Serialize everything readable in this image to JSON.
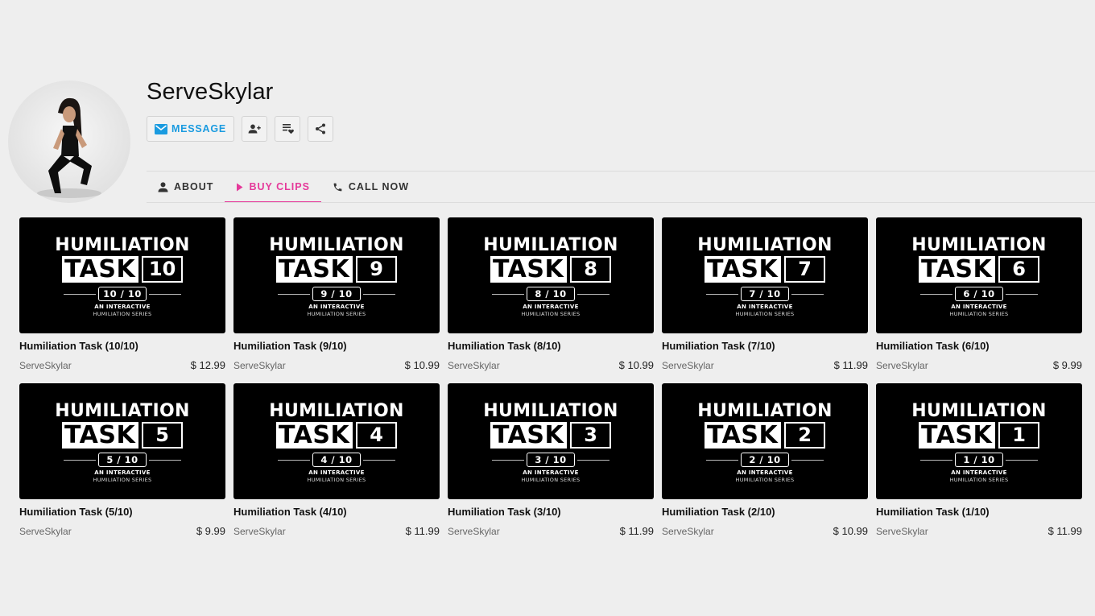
{
  "profile": {
    "name": "ServeSkylar"
  },
  "actions": {
    "message_label": "MESSAGE"
  },
  "tabs": [
    {
      "label": "ABOUT",
      "icon": "person-icon",
      "active": false
    },
    {
      "label": "BUY CLIPS",
      "icon": "play-icon",
      "active": true
    },
    {
      "label": "CALL NOW",
      "icon": "phone-icon",
      "active": false
    }
  ],
  "colors": {
    "accent_pink": "#e5399a",
    "message_blue": "#1a9be0",
    "background": "#eeeeee"
  },
  "thumbnail_text": {
    "line1": "HUMILIATION",
    "line2": "TASK",
    "sub1": "AN INTERACTIVE",
    "sub2": "HUMILIATION SERIES"
  },
  "clips": [
    {
      "title": "Humiliation Task (10/10)",
      "seller": "ServeSkylar",
      "price": "$ 12.99",
      "num": "10",
      "fraction": "10 / 10"
    },
    {
      "title": "Humiliation Task (9/10)",
      "seller": "ServeSkylar",
      "price": "$ 10.99",
      "num": "9",
      "fraction": "9 / 10"
    },
    {
      "title": "Humiliation Task (8/10)",
      "seller": "ServeSkylar",
      "price": "$ 10.99",
      "num": "8",
      "fraction": "8 / 10"
    },
    {
      "title": "Humiliation Task (7/10)",
      "seller": "ServeSkylar",
      "price": "$ 11.99",
      "num": "7",
      "fraction": "7 / 10"
    },
    {
      "title": "Humiliation Task (6/10)",
      "seller": "ServeSkylar",
      "price": "$ 9.99",
      "num": "6",
      "fraction": "6 / 10"
    },
    {
      "title": "Humiliation Task (5/10)",
      "seller": "ServeSkylar",
      "price": "$ 9.99",
      "num": "5",
      "fraction": "5 / 10"
    },
    {
      "title": "Humiliation Task (4/10)",
      "seller": "ServeSkylar",
      "price": "$ 11.99",
      "num": "4",
      "fraction": "4 / 10"
    },
    {
      "title": "Humiliation Task (3/10)",
      "seller": "ServeSkylar",
      "price": "$ 11.99",
      "num": "3",
      "fraction": "3 / 10"
    },
    {
      "title": "Humiliation Task (2/10)",
      "seller": "ServeSkylar",
      "price": "$ 10.99",
      "num": "2",
      "fraction": "2 / 10"
    },
    {
      "title": "Humiliation Task (1/10)",
      "seller": "ServeSkylar",
      "price": "$ 11.99",
      "num": "1",
      "fraction": "1 / 10"
    }
  ]
}
